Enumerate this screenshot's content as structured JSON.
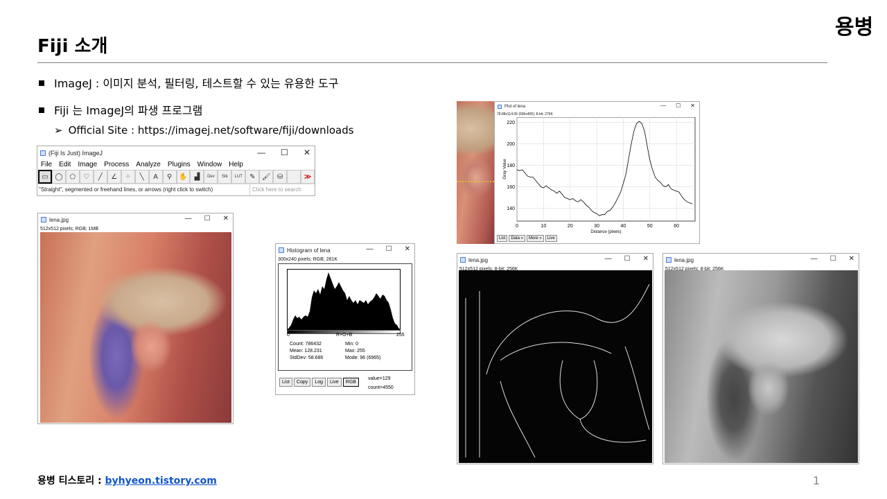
{
  "slide": {
    "title": "Fiji 소개",
    "brand": "용병",
    "bullets": [
      "ImageJ : 이미지 분석, 필터링, 테스트할 수 있는 유용한 도구",
      "Fiji 는 ImageJ의 파생 프로그램"
    ],
    "sub_arrow": "➢",
    "sub_bullet": "Official Site : https://imagej.net/software/fiji/downloads",
    "footer_label": "용병 티스토리 : ",
    "footer_link": "byhyeon.tistory.com",
    "page_number": "1"
  },
  "window_controls": {
    "minimize": "—",
    "maximize": "☐",
    "close": "✕"
  },
  "imagej": {
    "title": "(Fiji Is Just) ImageJ",
    "menu": [
      "File",
      "Edit",
      "Image",
      "Process",
      "Analyze",
      "Plugins",
      "Window",
      "Help"
    ],
    "tools": [
      "▭",
      "◯",
      "⬠",
      "♡",
      "╱",
      "∠",
      "⁘",
      "╲",
      "A",
      "⚲",
      "✋",
      "▟",
      "Dev",
      "Stk",
      "LUT",
      "✎",
      "🖌",
      "⛁",
      "",
      "≫"
    ],
    "status": "\"Straight\", segmented or freehand lines, or arrows (right click to switch)",
    "search_placeholder": "Click here to search"
  },
  "lena_color": {
    "title": "lena.jpg",
    "info": "512x512 pixels; RGB; 1MB"
  },
  "histogram": {
    "title": "Histogram of lena",
    "info": "300x240 pixels; RGB; 281K",
    "axis_min": "0",
    "axis_mid": "R+G+B",
    "axis_max": "255",
    "stats_left": [
      "Count: 786432",
      "Mean: 128.231",
      "StdDev: 58.686"
    ],
    "stats_right": [
      "Min: 0",
      "Max: 255",
      "Mode: 96 (6965)"
    ],
    "buttons": [
      "List",
      "Copy",
      "Log",
      "Live",
      "RGB"
    ],
    "value": "value=129",
    "count": "count=4550"
  },
  "plot": {
    "title": "Plot of lena",
    "info": "78.88x114.06  (696x405); 8-bit; 275K",
    "ylabel": "Gray Value",
    "xlabel": "Distance (pixels)",
    "buttons": [
      "List",
      "Data »",
      "More »",
      "Live"
    ]
  },
  "lena_edge": {
    "title": "lena.jpg",
    "info": "512x512 pixels; 8-bit; 256K"
  },
  "lena_gray": {
    "title": "lena.jpg",
    "info": "512x512 pixels; 8-bit; 256K"
  },
  "chart_data": {
    "type": "line",
    "xlabel": "Distance (pixels)",
    "ylabel": "Gray Value",
    "xlim": [
      0,
      67
    ],
    "ylim": [
      128,
      225
    ],
    "xticks": [
      0,
      10,
      20,
      30,
      40,
      50,
      60
    ],
    "yticks": [
      140,
      160,
      180,
      200,
      220
    ],
    "x": [
      0,
      1,
      2,
      3,
      4,
      5,
      6,
      7,
      8,
      9,
      10,
      11,
      12,
      13,
      14,
      15,
      16,
      17,
      18,
      19,
      20,
      21,
      22,
      23,
      24,
      25,
      26,
      27,
      28,
      29,
      30,
      31,
      32,
      33,
      34,
      35,
      36,
      37,
      38,
      39,
      40,
      41,
      42,
      43,
      44,
      45,
      46,
      47,
      48,
      49,
      50,
      51,
      52,
      53,
      54,
      55,
      56,
      57,
      58,
      59,
      60,
      61,
      62,
      63,
      64,
      65,
      66
    ],
    "y": [
      176,
      175,
      176,
      173,
      170,
      169,
      169,
      166,
      163,
      160,
      159,
      161,
      159,
      157,
      156,
      154,
      156,
      153,
      150,
      149,
      148,
      149,
      147,
      146,
      148,
      146,
      143,
      141,
      138,
      136,
      135,
      133,
      134,
      134,
      137,
      138,
      141,
      145,
      150,
      155,
      163,
      172,
      186,
      200,
      212,
      219,
      221,
      219,
      212,
      198,
      185,
      176,
      169,
      166,
      164,
      161,
      160,
      162,
      158,
      157,
      156,
      155,
      151,
      148,
      146,
      145,
      144
    ]
  }
}
